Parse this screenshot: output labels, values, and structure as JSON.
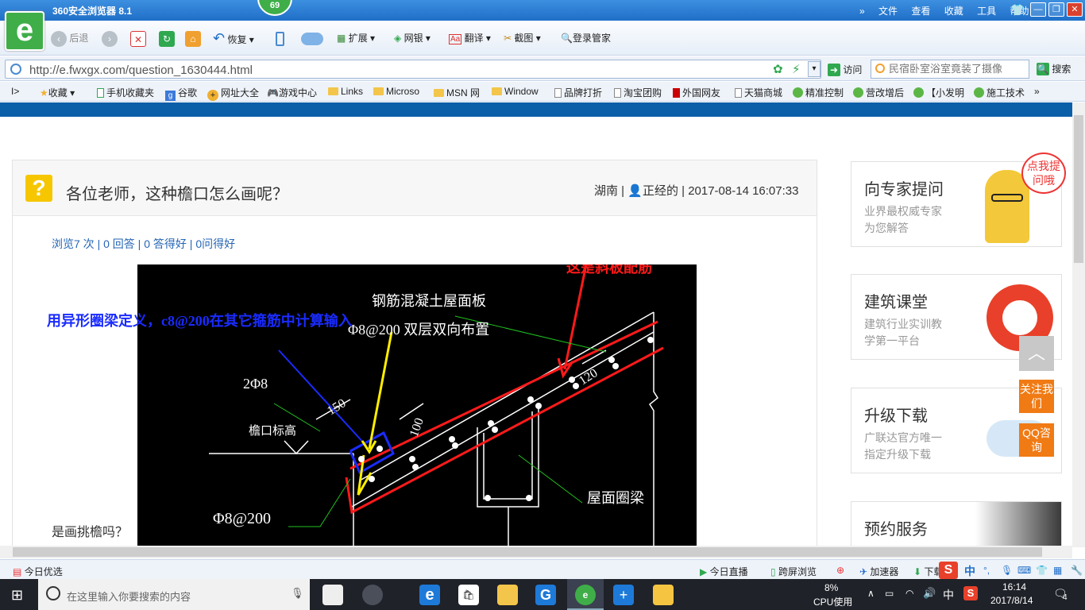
{
  "browser": {
    "title": "360安全浏览器 8.1",
    "badge": "69",
    "menu": [
      "文件",
      "查看",
      "收藏",
      "工具",
      "帮助"
    ],
    "back_label": "后退",
    "restore_label": "恢复",
    "ext_buttons": [
      "扩展",
      "网银",
      "翻译",
      "截图",
      "登录管家"
    ],
    "url": "http://e.fwxgx.com/question_1630444.html",
    "visit_label": "访问",
    "search_placeholder": "民宿卧室浴室竟装了摄像",
    "search_label": "搜索"
  },
  "bookmarks": [
    "收藏",
    "手机收藏夹",
    "谷歌",
    "网址大全",
    "游戏中心",
    "Links",
    "Microso",
    "MSN 网",
    "Window",
    "品牌打折",
    "淘宝团购",
    "外国网友",
    "天猫商城",
    "精准控制",
    "营改增后",
    "【小发明",
    "施工技术"
  ],
  "question": {
    "title": "各位老师，这种檐口怎么画呢？",
    "region": "湖南",
    "user": "正经的",
    "datetime": "2017-08-14 16:07:33",
    "views": "浏览7 次",
    "answers": "0 回答",
    "good_answers": "0 答得好",
    "good_questions": "0问得好",
    "footer": "是画挑檐吗？"
  },
  "cad": {
    "red_note": "这是斜板配筋",
    "blue_note": "用异形圈梁定义，c8@200在其它箍筋中计算输入",
    "slab_note": "钢筋混凝土屋面板",
    "slab_rebar": "Φ8@200 双层双向布置",
    "top_rebar": "2Φ8",
    "dim_150": "150",
    "dim_120": "120",
    "dim_100": "100",
    "eave_level": "檐口标高",
    "stirrup": "Φ8@200",
    "ring_beam": "屋面圈梁"
  },
  "sidebar": {
    "cards": [
      {
        "title": "向专家提问",
        "sub1": "业界最权威专家",
        "sub2": "为您解答",
        "bubble": "点我提问哦"
      },
      {
        "title": "建筑课堂",
        "sub1": "建筑行业实训教",
        "sub2": "学第一平台"
      },
      {
        "title": "升级下载",
        "sub1": "广联达官方唯一",
        "sub2": "指定升级下载"
      },
      {
        "title": "预约服务"
      }
    ],
    "float_follow": "关注我们",
    "float_qq": "QQ咨询"
  },
  "statusbar": {
    "left": "今日优选",
    "live": "今日直播",
    "screen": "跨屏浏览",
    "accel": "加速器",
    "download": "下载",
    "ime": "中"
  },
  "taskbar": {
    "search_placeholder": "在这里输入你要搜索的内容",
    "cpu_percent": "8%",
    "cpu_label": "CPU使用",
    "ime": "中",
    "time": "16:14",
    "date": "2017/8/14",
    "notifications": "4"
  }
}
